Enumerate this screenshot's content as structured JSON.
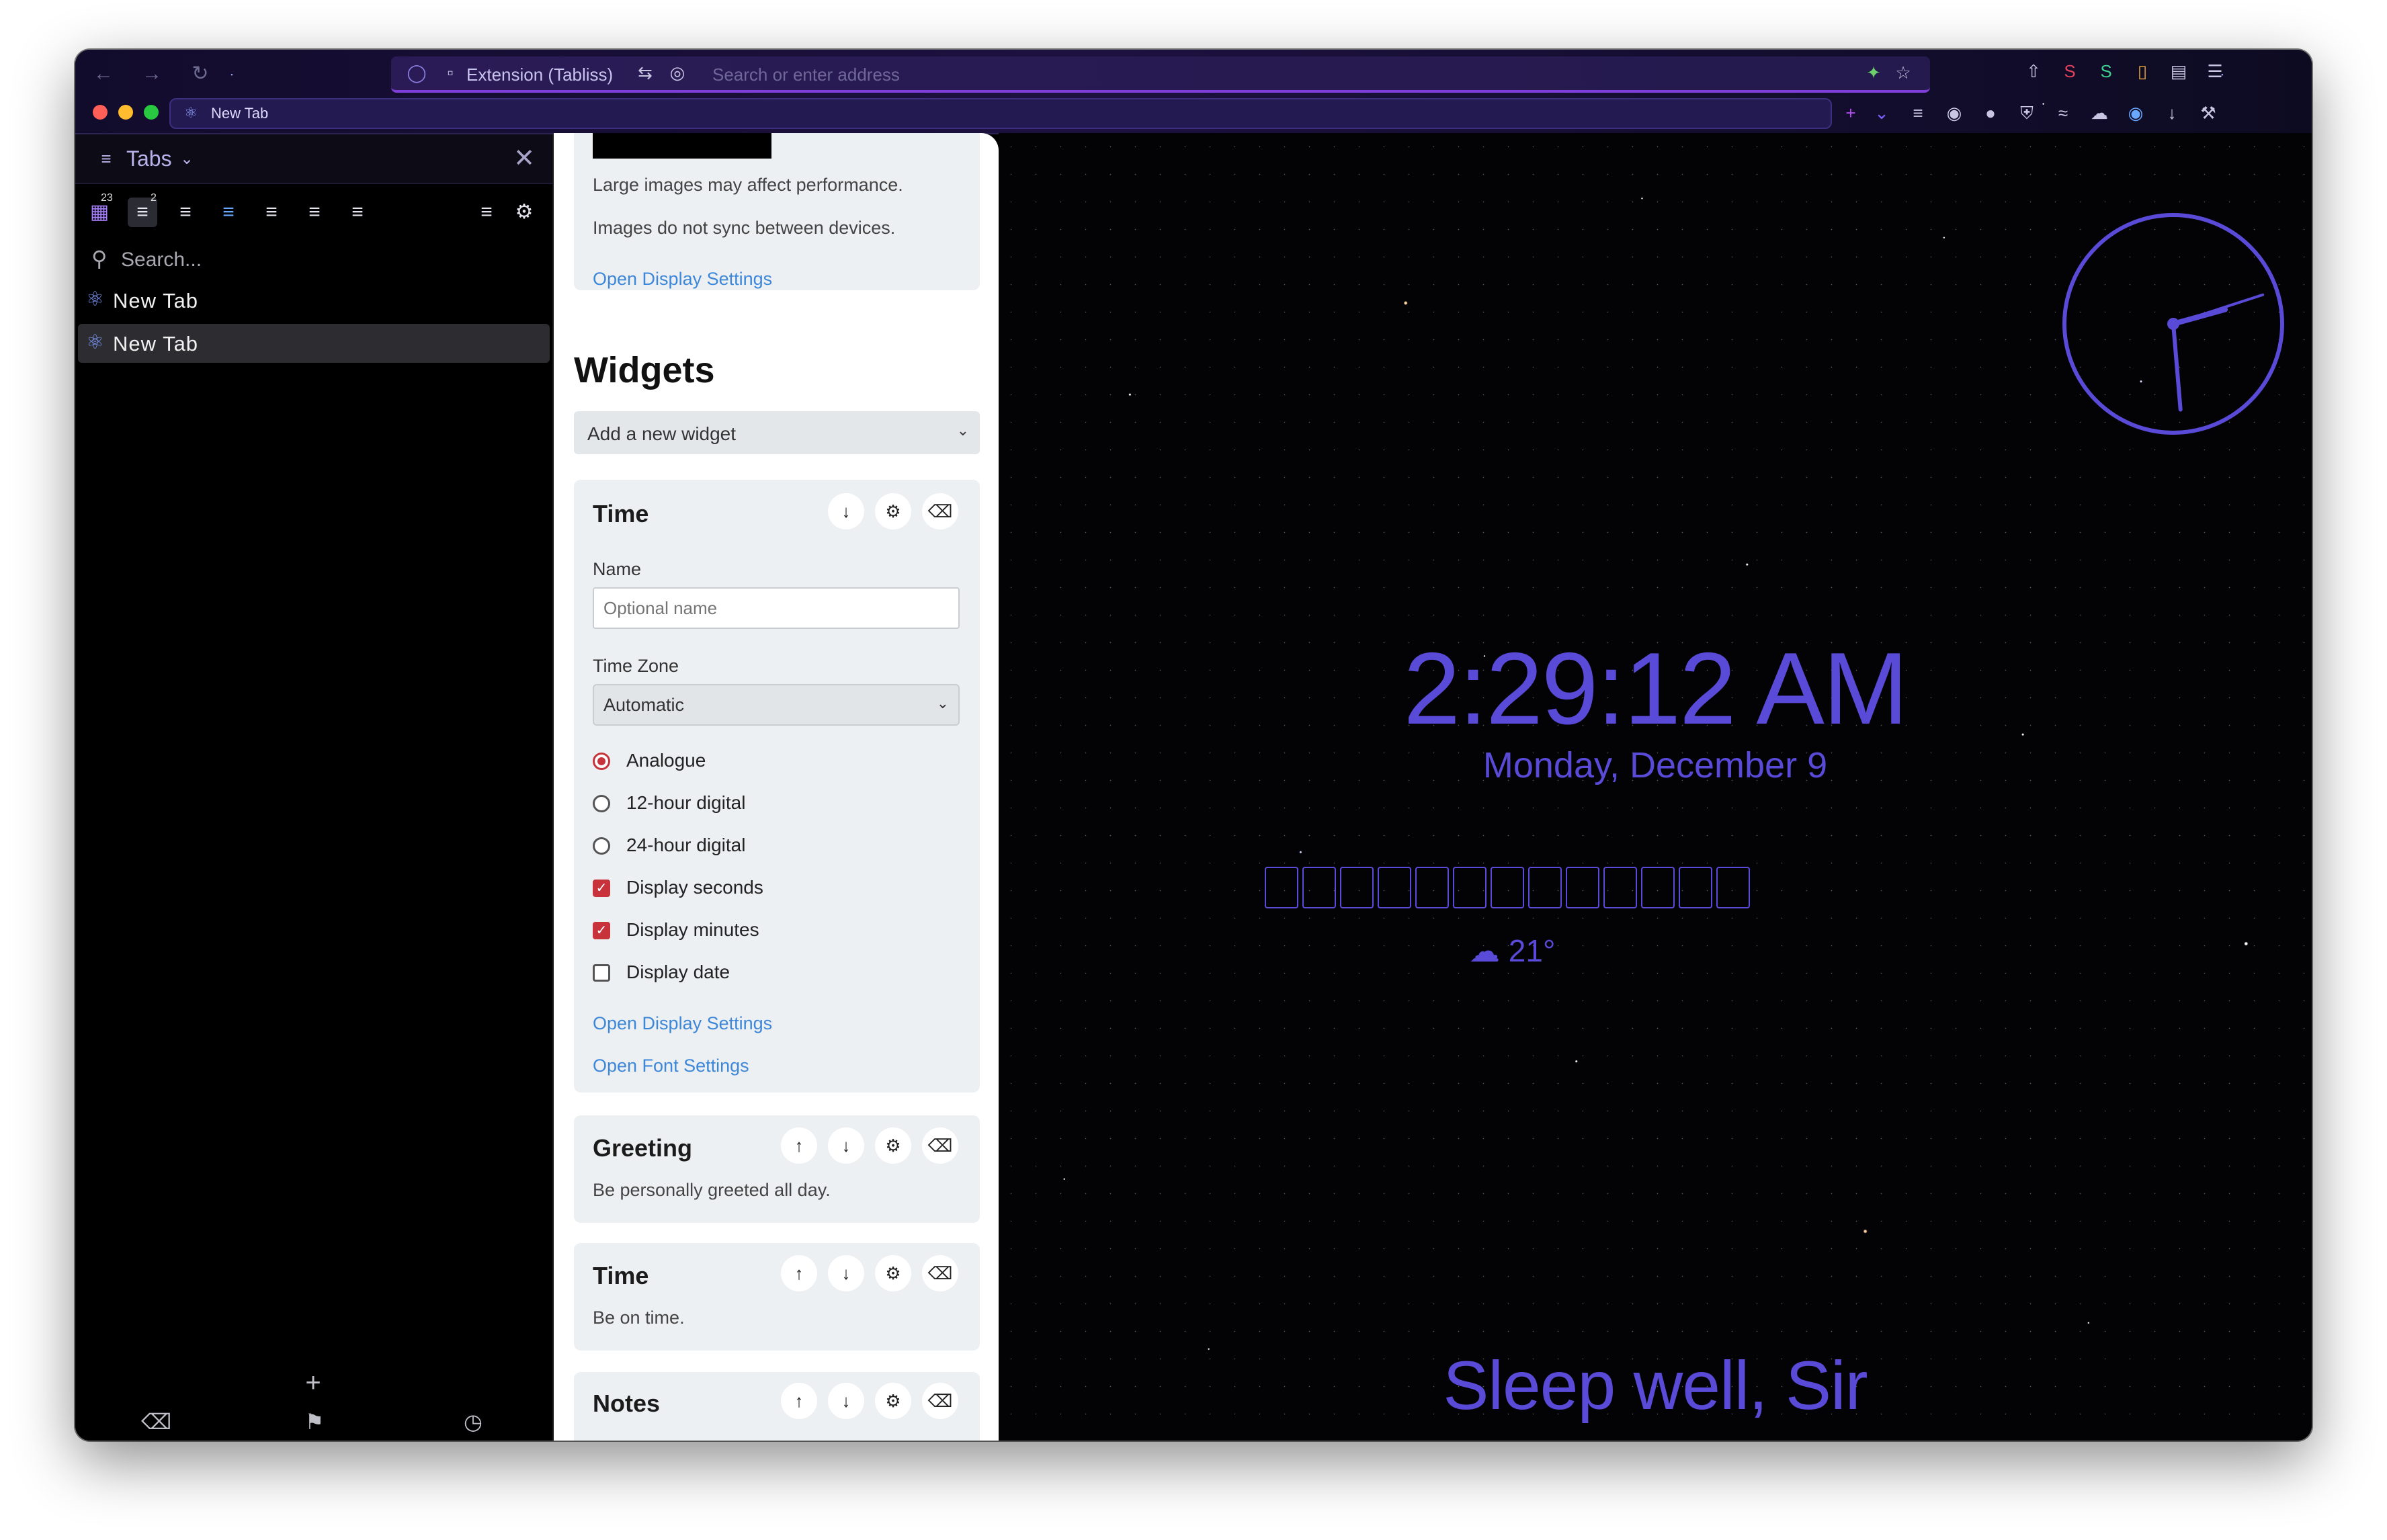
{
  "browser": {
    "url_bar": {
      "extension_label": "Extension (Tabliss)",
      "placeholder": "Search or enter address"
    },
    "active_tab_label": "New Tab"
  },
  "sidebar": {
    "title": "Tabs",
    "badge_counts": [
      "23",
      "2"
    ],
    "search_placeholder": "Search...",
    "tabs": [
      {
        "label": "New Tab",
        "active": false
      },
      {
        "label": "New Tab",
        "active": true
      }
    ],
    "add_label": "+"
  },
  "settings_panel": {
    "background_notes": [
      "Large images may affect performance.",
      "Images do not sync between devices."
    ],
    "open_display_settings": "Open Display Settings",
    "widgets_heading": "Widgets",
    "add_widget_select": "Add a new widget",
    "time_widget": {
      "title": "Time",
      "name_label": "Name",
      "name_placeholder": "Optional name",
      "timezone_label": "Time Zone",
      "timezone_value": "Automatic",
      "options": [
        {
          "label": "Analogue",
          "type": "radio",
          "checked": true
        },
        {
          "label": "12-hour digital",
          "type": "radio",
          "checked": false
        },
        {
          "label": "24-hour digital",
          "type": "radio",
          "checked": false
        },
        {
          "label": "Display seconds",
          "type": "checkbox",
          "checked": true
        },
        {
          "label": "Display minutes",
          "type": "checkbox",
          "checked": true
        },
        {
          "label": "Display date",
          "type": "checkbox",
          "checked": false
        }
      ],
      "open_display_settings": "Open Display Settings",
      "open_font_settings": "Open Font Settings"
    },
    "collapsed_widgets": [
      {
        "title": "Greeting",
        "description": "Be personally greeted all day."
      },
      {
        "title": "Time",
        "description": "Be on time."
      },
      {
        "title": "Notes",
        "description": ""
      }
    ]
  },
  "new_tab_page": {
    "time": "2:29:12 AM",
    "date": "Monday, December 9",
    "weather_temp": "21°",
    "greeting": "Sleep well, Sir",
    "accent_color": "#5a4ad8",
    "analog_clock": {
      "hour": 2,
      "minute": 29,
      "second": 12
    }
  }
}
